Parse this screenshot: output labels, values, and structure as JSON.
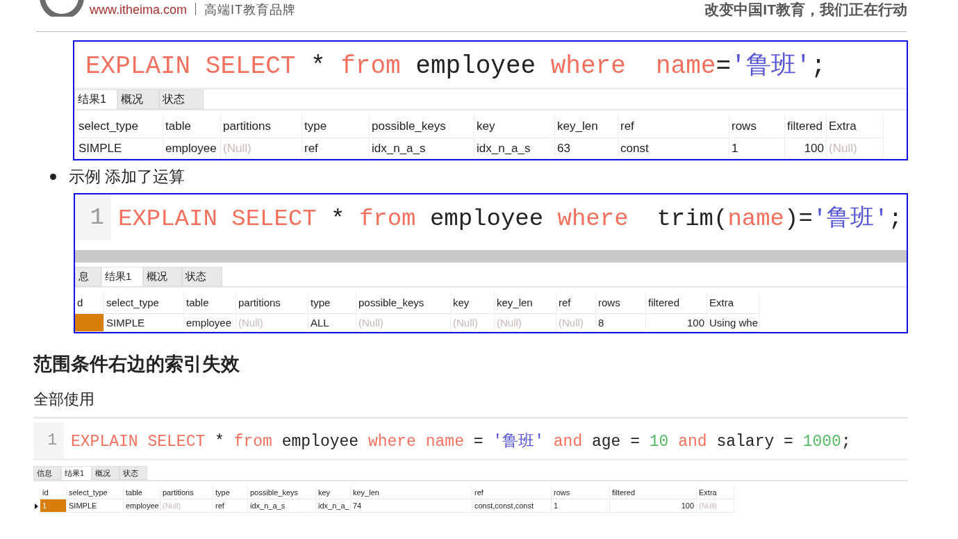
{
  "header": {
    "site": "www.itheima.com",
    "brand_tagline": "高端IT教育品牌",
    "slogan": "改变中国IT教育，我们正在行动"
  },
  "panels": [
    {
      "code": [
        {
          "text": "EXPLAIN SELECT",
          "kind": "keyword"
        },
        {
          "text": " * ",
          "kind": "plain"
        },
        {
          "text": "from",
          "kind": "keyword"
        },
        {
          "text": " employee ",
          "kind": "plain"
        },
        {
          "text": "where  name",
          "kind": "keyword"
        },
        {
          "text": "=",
          "kind": "plain"
        },
        {
          "text": "'鲁班'",
          "kind": "string"
        },
        {
          "text": ";",
          "kind": "plain"
        }
      ],
      "tabs": [
        {
          "label": "结果1",
          "selected": true
        },
        {
          "label": "概况",
          "selected": false
        },
        {
          "label": "状态",
          "selected": false
        }
      ],
      "columns": [
        "select_type",
        "table",
        "partitions",
        "type",
        "possible_keys",
        "key",
        "key_len",
        "ref",
        "rows",
        "filtered",
        "Extra"
      ],
      "rows": [
        {
          "cells": [
            {
              "text": "SIMPLE",
              "kind": "text"
            },
            {
              "text": "employee",
              "kind": "text"
            },
            {
              "text": "(Null)",
              "kind": "null"
            },
            {
              "text": "ref",
              "kind": "text"
            },
            {
              "text": "idx_n_a_s",
              "kind": "text"
            },
            {
              "text": "idx_n_a_s",
              "kind": "text"
            },
            {
              "text": "63",
              "kind": "text"
            },
            {
              "text": "const",
              "kind": "text"
            },
            {
              "text": "1",
              "kind": "text"
            },
            {
              "text": "100",
              "kind": "number"
            },
            {
              "text": "(Null)",
              "kind": "null"
            }
          ]
        }
      ]
    },
    {
      "bullet": "示例 添加了运算",
      "line_number": "1",
      "code": [
        {
          "text": "EXPLAIN SELECT",
          "kind": "keyword"
        },
        {
          "text": " * ",
          "kind": "plain"
        },
        {
          "text": "from",
          "kind": "keyword"
        },
        {
          "text": " employee ",
          "kind": "plain"
        },
        {
          "text": "where",
          "kind": "keyword"
        },
        {
          "text": "  trim(",
          "kind": "plain"
        },
        {
          "text": "name",
          "kind": "keyword"
        },
        {
          "text": ")=",
          "kind": "plain"
        },
        {
          "text": "'鲁班'",
          "kind": "string"
        },
        {
          "text": ";",
          "kind": "plain"
        }
      ],
      "tabs": [
        {
          "label": "息",
          "selected": false
        },
        {
          "label": "结果1",
          "selected": true
        },
        {
          "label": "概况",
          "selected": false
        },
        {
          "label": "状态",
          "selected": false
        }
      ],
      "columns": [
        "d",
        "select_type",
        "table",
        "partitions",
        "type",
        "possible_keys",
        "key",
        "key_len",
        "ref",
        "rows",
        "filtered",
        "Extra"
      ],
      "rows": [
        {
          "cells": [
            {
              "kind": "highlight"
            },
            {
              "text": "SIMPLE",
              "kind": "text"
            },
            {
              "text": "employee",
              "kind": "text"
            },
            {
              "text": "(Null)",
              "kind": "null"
            },
            {
              "text": "ALL",
              "kind": "text"
            },
            {
              "text": "(Null)",
              "kind": "null"
            },
            {
              "text": "(Null)",
              "kind": "null"
            },
            {
              "text": "(Null)",
              "kind": "null"
            },
            {
              "text": "(Null)",
              "kind": "null"
            },
            {
              "text": "8",
              "kind": "text"
            },
            {
              "text": "100",
              "kind": "number"
            },
            {
              "text": "Using whe",
              "kind": "text"
            }
          ]
        }
      ]
    },
    {
      "heading": "范围条件右边的索引失效",
      "subheading": "全部使用",
      "line_number": "1",
      "code": [
        {
          "text": "EXPLAIN SELECT",
          "kind": "keyword"
        },
        {
          "text": " * ",
          "kind": "plain"
        },
        {
          "text": "from",
          "kind": "keyword"
        },
        {
          "text": " employee ",
          "kind": "plain"
        },
        {
          "text": "where name",
          "kind": "keyword"
        },
        {
          "text": " = ",
          "kind": "plain"
        },
        {
          "text": "'鲁班'",
          "kind": "string"
        },
        {
          "text": " and",
          "kind": "keyword"
        },
        {
          "text": " age = ",
          "kind": "plain"
        },
        {
          "text": "10",
          "kind": "number"
        },
        {
          "text": " and",
          "kind": "keyword"
        },
        {
          "text": " salary = ",
          "kind": "plain"
        },
        {
          "text": "1000",
          "kind": "number"
        },
        {
          "text": ";",
          "kind": "plain"
        }
      ],
      "tabs": [
        {
          "label": "信息",
          "selected": false
        },
        {
          "label": "结果1",
          "selected": true
        },
        {
          "label": "概况",
          "selected": false
        },
        {
          "label": "状态",
          "selected": false
        }
      ],
      "columns": [
        "id",
        "select_type",
        "table",
        "partitions",
        "type",
        "possible_keys",
        "key",
        "key_len",
        "ref",
        "rows",
        "filtered",
        "Extra"
      ],
      "rows": [
        {
          "current": true,
          "cells": [
            {
              "text": "1",
              "kind": "highlight"
            },
            {
              "text": "SIMPLE",
              "kind": "text"
            },
            {
              "text": "employee",
              "kind": "text"
            },
            {
              "text": "(Null)",
              "kind": "null"
            },
            {
              "text": "ref",
              "kind": "text"
            },
            {
              "text": "idx_n_a_s",
              "kind": "text"
            },
            {
              "text": "idx_n_a_",
              "kind": "text"
            },
            {
              "text": "74",
              "kind": "text"
            },
            {
              "text": "const,const,const",
              "kind": "text"
            },
            {
              "text": "1",
              "kind": "text"
            },
            {
              "text": "100",
              "kind": "number"
            },
            {
              "text": "(Null)",
              "kind": "null"
            }
          ]
        }
      ]
    }
  ]
}
